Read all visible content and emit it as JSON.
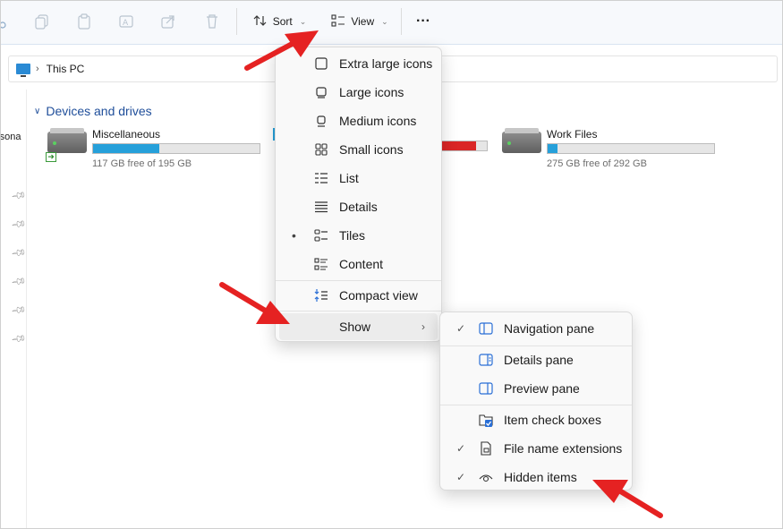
{
  "toolbar": {
    "sort_label": "Sort",
    "view_label": "View",
    "more_label": "···"
  },
  "address": {
    "location": "This PC"
  },
  "sidebar": {
    "partial_label": "rsona"
  },
  "section": {
    "title": "Devices and drives"
  },
  "drives": [
    {
      "name": "Miscellaneous",
      "free_text": "117 GB free of 195 GB",
      "used_fraction": 0.4,
      "color": "#26a0da"
    },
    {
      "name": "Work Files",
      "free_text": "275 GB free of 292 GB",
      "used_fraction": 0.06,
      "color": "#26a0da"
    }
  ],
  "view_menu": {
    "items": [
      {
        "label": "Extra large icons",
        "icon": "extra-large-icons-icon"
      },
      {
        "label": "Large icons",
        "icon": "large-icons-icon"
      },
      {
        "label": "Medium icons",
        "icon": "medium-icons-icon"
      },
      {
        "label": "Small icons",
        "icon": "small-icons-icon"
      },
      {
        "label": "List",
        "icon": "list-icon"
      },
      {
        "label": "Details",
        "icon": "details-icon"
      },
      {
        "label": "Tiles",
        "icon": "tiles-icon",
        "selected": true
      },
      {
        "label": "Content",
        "icon": "content-icon"
      }
    ],
    "compact_label": "Compact view",
    "show_label": "Show"
  },
  "show_menu": {
    "items": [
      {
        "label": "Navigation pane",
        "checked": true,
        "icon": "navigation-pane-icon"
      },
      {
        "label": "Details pane",
        "checked": false,
        "icon": "details-pane-icon"
      },
      {
        "label": "Preview pane",
        "checked": false,
        "icon": "preview-pane-icon"
      },
      {
        "label": "Item check boxes",
        "checked": false,
        "icon": "item-check-boxes-icon"
      },
      {
        "label": "File name extensions",
        "checked": true,
        "icon": "file-extension-icon"
      },
      {
        "label": "Hidden items",
        "checked": true,
        "icon": "eye-icon"
      }
    ],
    "check_glyph": "✓",
    "bullet_glyph": "•"
  },
  "colors": {
    "accent": "#26a0da",
    "warning": "#da2626",
    "annotation_arrow": "#e52222",
    "section_header": "#1f4e9a"
  }
}
